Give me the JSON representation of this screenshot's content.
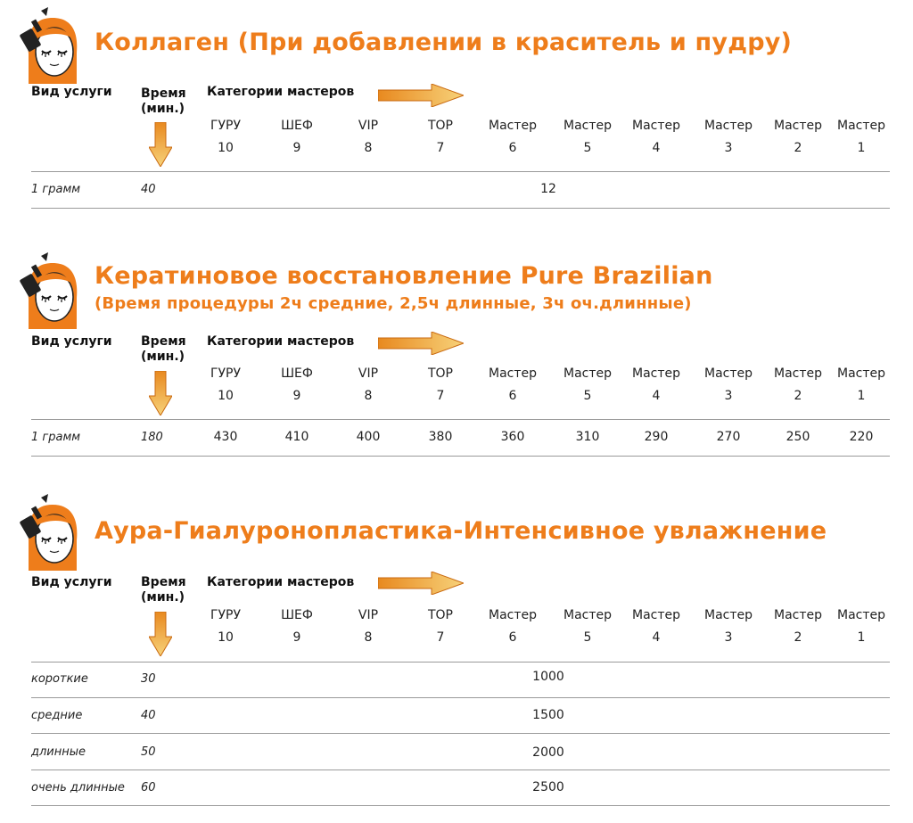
{
  "colors": {
    "accent": "#ee7d1b",
    "arrow": "#f0a93a",
    "line": "#9a9a9a"
  },
  "icons": [
    "woman-face-brush-icon",
    "arrow-right-icon",
    "arrow-down-icon"
  ],
  "header": {
    "service": "Вид услуги",
    "time_line1": "Время",
    "time_line2": "(мин.)",
    "categories": "Категории мастеров"
  },
  "columns": [
    {
      "name": "ГУРУ",
      "num": "10"
    },
    {
      "name": "ШЕФ",
      "num": "9"
    },
    {
      "name": "VIP",
      "num": "8"
    },
    {
      "name": "TOP",
      "num": "7"
    },
    {
      "name": "Мастер",
      "num": "6"
    },
    {
      "name": "Мастер",
      "num": "5"
    },
    {
      "name": "Мастер",
      "num": "4"
    },
    {
      "name": "Мастер",
      "num": "3"
    },
    {
      "name": "Мастер",
      "num": "2"
    },
    {
      "name": "Мастер",
      "num": "1"
    }
  ],
  "sections": [
    {
      "title_line1": "Коллаген (При добавлении в краситель и пудру)",
      "rows": [
        {
          "service": "1 грамм",
          "time": "40",
          "price": "12"
        }
      ]
    },
    {
      "title_line1": "Кератиновое восстановление Pure Brazilian",
      "title_line2": "(Время процедуры 2ч средние, 2,5ч длинные, 3ч оч.длинные)",
      "rows": [
        {
          "service": "1 грамм",
          "time": "180",
          "prices": [
            "430",
            "410",
            "400",
            "380",
            "360",
            "310",
            "290",
            "270",
            "250",
            "220"
          ]
        }
      ]
    },
    {
      "title_line1": "Аура-Гиалуронопластика-Интенсивное увлажнение",
      "rows": [
        {
          "service": "короткие",
          "time": "30",
          "price": "1000"
        },
        {
          "service": "средние",
          "time": "40",
          "price": "1500"
        },
        {
          "service": "длинные",
          "time": "50",
          "price": "2000"
        },
        {
          "service": "очень длинные",
          "time": "60",
          "price": "2500"
        }
      ]
    }
  ]
}
